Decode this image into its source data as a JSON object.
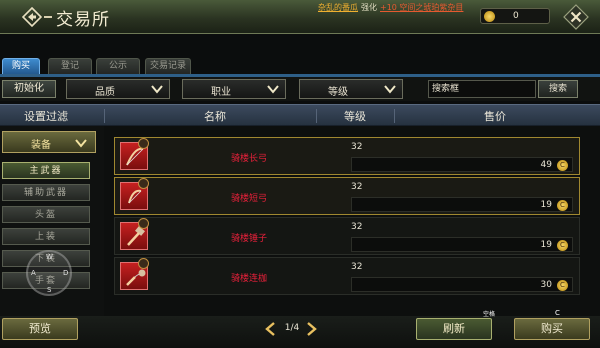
{
  "window": {
    "title": "交易所",
    "logo_icon": "diamond-arrow-icon",
    "close_icon": "close-x-icon"
  },
  "notice": {
    "part1": "杂乱的番瓜",
    "part2": "强化",
    "part3": "+10 空间之琥珀紫杂目"
  },
  "gold": {
    "icon": "gold-coin-icon",
    "value": "0"
  },
  "tabs": [
    {
      "label": "购买",
      "active": true
    },
    {
      "label": "登记",
      "active": false
    },
    {
      "label": "公示",
      "active": false
    },
    {
      "label": "交易记录",
      "active": false
    }
  ],
  "filter": {
    "reset_label": "初始化",
    "dropdowns": [
      {
        "label": "品质"
      },
      {
        "label": "职业"
      },
      {
        "label": "等级"
      }
    ],
    "search_value": "搜索框",
    "search_button": "搜索"
  },
  "header": {
    "filter_setting": "设置过滤",
    "name": "名称",
    "level": "等级",
    "price": "售价"
  },
  "sidebar": {
    "category": "装备",
    "subcategories": [
      {
        "label": "主武器",
        "active": true
      },
      {
        "label": "辅助武器",
        "active": false
      },
      {
        "label": "头盔",
        "active": false
      },
      {
        "label": "上装",
        "active": false
      },
      {
        "label": "下装",
        "active": false
      },
      {
        "label": "手套",
        "active": false
      }
    ],
    "joystick": {
      "n": "W",
      "s": "S",
      "w": "A",
      "e": "D"
    }
  },
  "items": [
    {
      "name": "骑楼长弓",
      "level": "32",
      "price": "49",
      "selected": true,
      "icon": "longbow-icon"
    },
    {
      "name": "骑楼短弓",
      "level": "32",
      "price": "19",
      "selected": true,
      "icon": "shortbow-icon"
    },
    {
      "name": "骑楼锤子",
      "level": "32",
      "price": "19",
      "selected": false,
      "icon": "hammer-icon"
    },
    {
      "name": "骑楼连枷",
      "level": "32",
      "price": "30",
      "selected": false,
      "icon": "flail-icon"
    }
  ],
  "footer": {
    "preview_label": "预览",
    "page": "1/4",
    "refresh_label": "刷新",
    "buy_label": "购买",
    "hint_a": "空格",
    "hint_b": "C"
  },
  "colors": {
    "accent_blue": "#2e5f88",
    "item_name": "#e8203a",
    "gold": "#f0b030"
  }
}
